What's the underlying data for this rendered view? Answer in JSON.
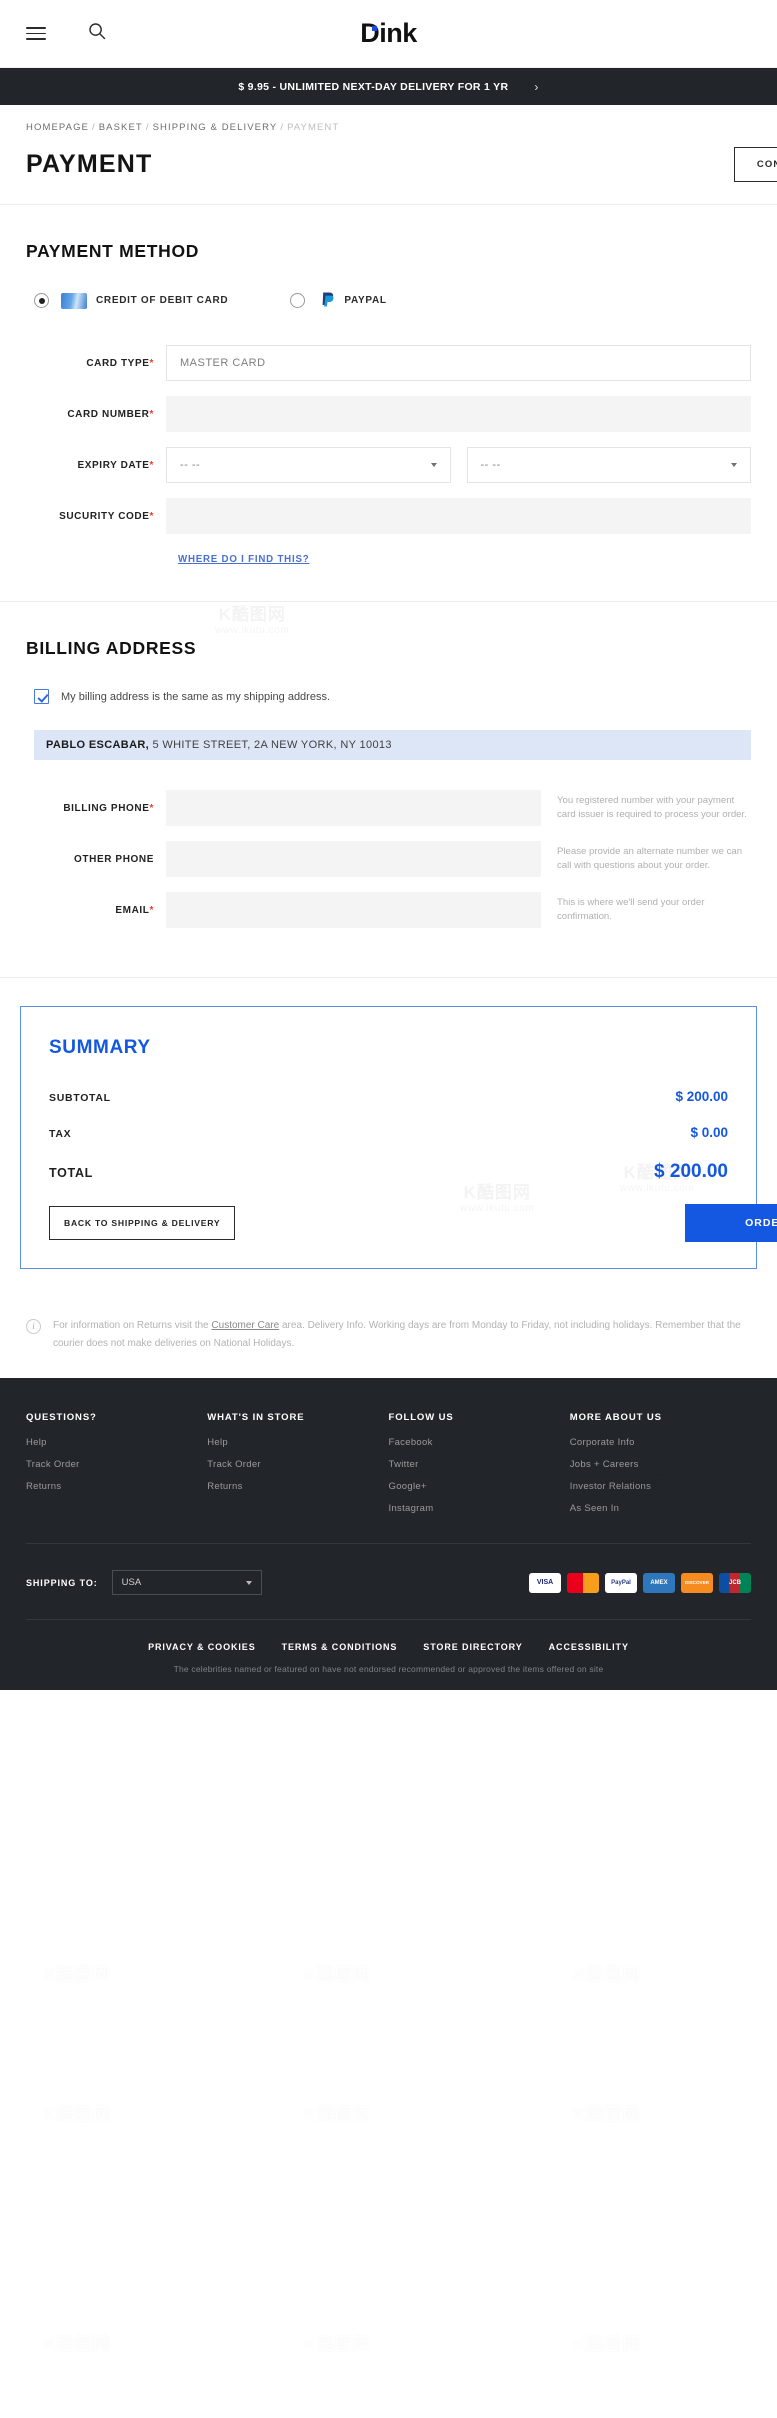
{
  "header": {
    "menu_icon": "hamburger-menu-icon",
    "search_icon": "search-icon",
    "brand": "Dink",
    "brand_prefix": "D",
    "brand_suffix": "ink"
  },
  "promo": {
    "text": "$ 9.95 - UNLIMITED NEXT-DAY DELIVERY FOR 1 YR",
    "chevron": "›"
  },
  "breadcrumb": {
    "items": [
      "HOMEPAGE",
      "BASKET",
      "SHIPPING & DELIVERY",
      "PAYMENT"
    ],
    "separator": "/"
  },
  "page": {
    "title": "PAYMENT",
    "continue_shopping": "CONTINUE SHOPPING"
  },
  "payment_method": {
    "heading": "PAYMENT METHOD",
    "options": [
      {
        "label": "CREDIT OF DEBIT CARD",
        "selected": true,
        "icon": "credit-card-icon"
      },
      {
        "label": "PAYPAL",
        "selected": false,
        "icon": "paypal-icon"
      }
    ],
    "fields": [
      {
        "label": "CARD TYPE",
        "required": true,
        "value": "MASTER CARD",
        "type": "text"
      },
      {
        "label": "CARD NUMBER",
        "required": true,
        "value": "",
        "type": "text"
      },
      {
        "label": "EXPIRY DATE",
        "required": true,
        "value": "-- --",
        "value2": "-- --",
        "type": "двух-select"
      },
      {
        "label": "SUCURITY CODE",
        "required": true,
        "value": "",
        "type": "text"
      }
    ],
    "expiry_month": "-- --",
    "expiry_year": "-- --",
    "help_link": "WHERE DO I FIND THIS?"
  },
  "billing": {
    "heading": "BILLING ADDRESS",
    "same_as_shipping_label": "My billing address is the same as my shipping address.",
    "same_as_shipping_checked": true,
    "address_name": "PABLO ESCABAR,",
    "address_rest": " 5 WHITE STREET, 2A NEW YORK, NY 10013",
    "fields": [
      {
        "label": "BILLING PHONE",
        "required": true,
        "value": "",
        "hint": "You registered number with your payment card issuer is required to process your order."
      },
      {
        "label": "OTHER PHONE",
        "required": false,
        "value": "",
        "hint": "Please provide an alternate number we can call with questions about your order."
      },
      {
        "label": "EMAIL",
        "required": true,
        "value": "",
        "hint": "This is where we'll send your order confirmation."
      }
    ]
  },
  "summary": {
    "heading": "SUMMARY",
    "lines": [
      {
        "label": "SUBTOTAL",
        "value": "$ 200.00"
      },
      {
        "label": "TAX",
        "value": "$ 0.00"
      }
    ],
    "total_label": "TOTAL",
    "total_value": "$ 200.00",
    "back_button": "BACK TO SHIPPING & DELIVERY",
    "order_button": "ORDER",
    "accent_color": "#1457e0"
  },
  "note": {
    "icon": "info-icon",
    "prefix": "For information on Returns visit the ",
    "link": "Customer Care",
    "suffix": " area. Delivery Info. Working days are from Monday to Friday, not including holidays. Remember that the courier does not make deliveries on National Holidays."
  },
  "footer": {
    "columns": [
      {
        "title": "QUESTIONS?",
        "links": [
          "Help",
          "Track Order",
          "Returns"
        ]
      },
      {
        "title": "WHAT'S IN STORE",
        "links": [
          "Help",
          "Track Order",
          "Returns"
        ]
      },
      {
        "title": "FOLLOW US",
        "links": [
          "Facebook",
          "Twitter",
          "Google+",
          "Instagram"
        ]
      },
      {
        "title": "MORE ABOUT US",
        "links": [
          "Corporate Info",
          "Jobs + Careers",
          "Investor Relations",
          "As Seen In"
        ]
      }
    ],
    "shipping_label": "SHIPPING TO:",
    "shipping_value": "USA",
    "payment_chips": [
      "VISA",
      "MC",
      "PayPal",
      "AMEX",
      "DISCOVER",
      "JCB"
    ],
    "legal_links": [
      "PRIVACY & COOKIES",
      "TERMS & CONDITIONS",
      "STORE DIRECTORY",
      "ACCESSIBILITY"
    ],
    "legal_note": "The celebrities named or featured on have not endorsed recommended or approved the items offered on site"
  },
  "watermark": {
    "line1": "K酷图网",
    "line2": "www.ikutu.com"
  }
}
